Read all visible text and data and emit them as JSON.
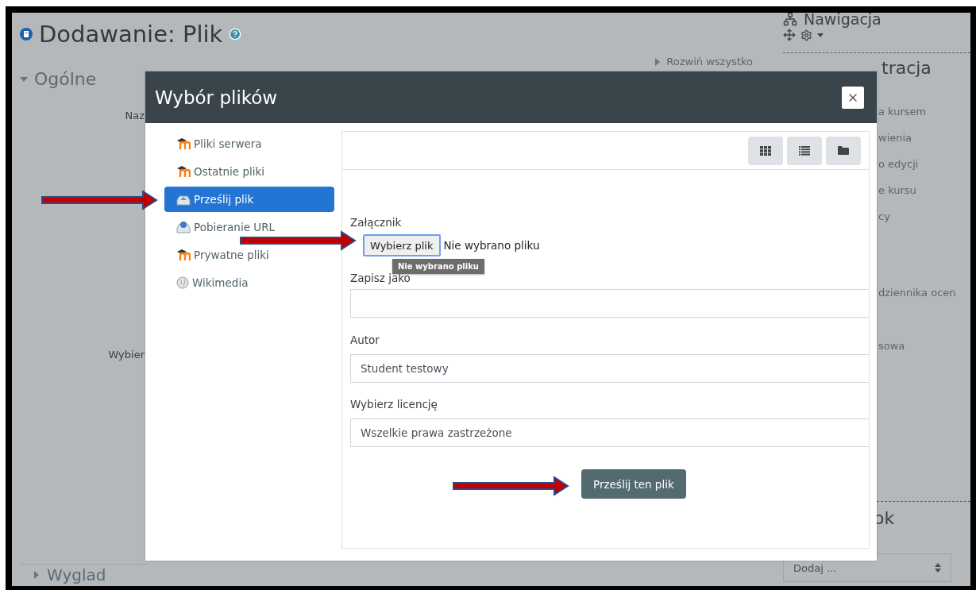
{
  "page": {
    "title": "Dodawanie: Plik",
    "expand_all": "Rozwiń wszystko",
    "section": "Ogólne",
    "field_labels": [
      "Naz",
      "Wybier"
    ],
    "next_section": "Wyglad"
  },
  "blocks": {
    "navigation_title": "Nawigacja",
    "admin_title": "tracja",
    "admin_items": [
      "a kursem",
      "wienia",
      "o edycji",
      "e kursu",
      "cy",
      "dziennika ocen",
      "sowa"
    ],
    "add_block_title": "ok",
    "add_select": "Dodaj ..."
  },
  "dialog": {
    "title": "Wybór plików",
    "repositories": [
      {
        "label": "Pliki serwera",
        "kind": "moodle",
        "selected": false
      },
      {
        "label": "Ostatnie pliki",
        "kind": "moodle",
        "selected": false
      },
      {
        "label": "Prześlij plik",
        "kind": "upload",
        "selected": true
      },
      {
        "label": "Pobieranie URL",
        "kind": "url",
        "selected": false
      },
      {
        "label": "Prywatne pliki",
        "kind": "moodle",
        "selected": false
      },
      {
        "label": "Wikimedia",
        "kind": "wikimedia",
        "selected": false
      }
    ],
    "attachment_label": "Załącznik",
    "choose_button": "Wybierz plik",
    "no_file": "Nie wybrano pliku",
    "tooltip": "Nie wybrano pliku",
    "save_as_label": "Zapisz jako",
    "author_label": "Autor",
    "author_value": "Student testowy",
    "license_label": "Wybierz licencję",
    "license_value": "Wszelkie prawa zastrzeżone",
    "upload_button": "Prześlij ten plik"
  }
}
